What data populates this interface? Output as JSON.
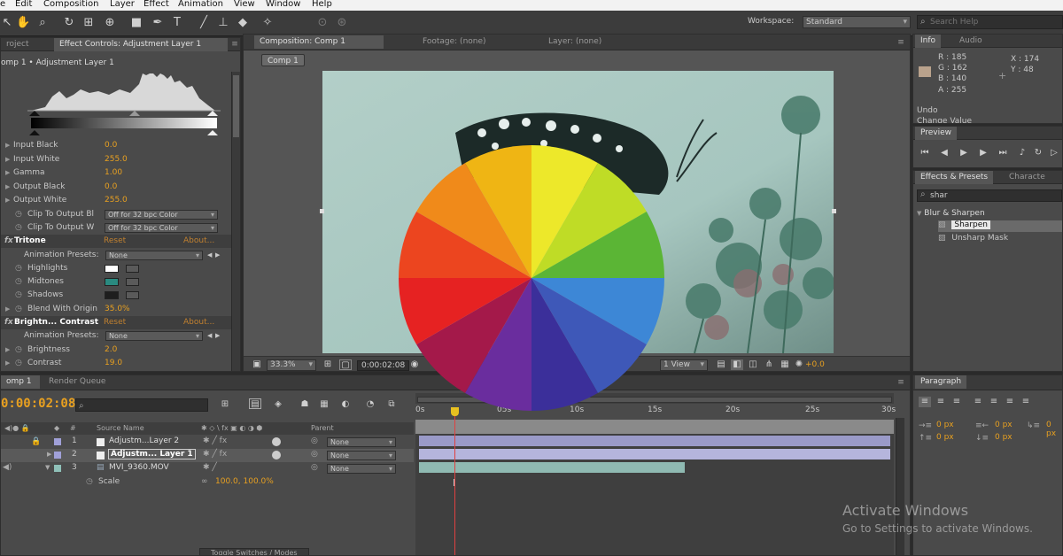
{
  "menu": [
    "e",
    "Edit",
    "Composition",
    "Layer",
    "Effect",
    "Animation",
    "View",
    "Window",
    "Help"
  ],
  "toolbar": {
    "workspace_label": "Workspace:",
    "workspace_value": "Standard",
    "search_placeholder": "Search Help"
  },
  "effect_panel": {
    "tab_project": "roject",
    "tab_effect_controls": "Effect Controls: Adjustment Layer 1",
    "breadcrumb": "omp 1 • Adjustment Layer 1",
    "levels": [
      {
        "label": "Input Black",
        "value": "0.0"
      },
      {
        "label": "Input White",
        "value": "255.0"
      },
      {
        "label": "Gamma",
        "value": "1.00"
      },
      {
        "label": "Output Black",
        "value": "0.0"
      },
      {
        "label": "Output White",
        "value": "255.0"
      },
      {
        "label": "Clip To Output Bl",
        "value": "Off for 32 bpc Color"
      },
      {
        "label": "Clip To Output W",
        "value": "Off for 32 bpc Color"
      }
    ],
    "tritone": {
      "name": "Tritone",
      "reset": "Reset",
      "about": "About...",
      "presets_label": "Animation Presets:",
      "presets_value": "None",
      "highlights": "Highlights",
      "midtones": "Midtones",
      "shadows": "Shadows",
      "blend_label": "Blend With Origin",
      "blend_value": "35.0%"
    },
    "brightness": {
      "name": "Brightn... Contrast",
      "reset": "Reset",
      "about": "About...",
      "presets_label": "Animation Presets:",
      "presets_value": "None",
      "brightness_label": "Brightness",
      "brightness_value": "2.0",
      "contrast_label": "Contrast",
      "contrast_value": "19.0"
    }
  },
  "comp_panel": {
    "tab_composition": "Composition: Comp 1",
    "tab_footage": "Footage: (none)",
    "tab_layer": "Layer: (none)",
    "comp_chip": "Comp 1",
    "zoom": "33.3%",
    "timecode": "0:00:02:08",
    "view": "1 View",
    "exposure": "+0.0"
  },
  "info_panel": {
    "tab_info": "Info",
    "tab_audio": "Audio",
    "r": "R : 185",
    "g": "G : 162",
    "b": "B : 140",
    "a": "A : 255",
    "x": "X : 174",
    "y": "Y : 48",
    "undo_label": "Undo",
    "undo_text": "Change Value"
  },
  "preview_panel": {
    "tab": "Preview"
  },
  "effects_presets": {
    "tab": "Effects & Presets",
    "tab2": "Characte",
    "search": "shar",
    "category": "Blur & Sharpen",
    "items": [
      "Sharpen",
      "Unsharp Mask"
    ]
  },
  "timeline": {
    "tab_comp": "omp 1",
    "tab_render": "Render Queue",
    "timecode": "0:00:02:08",
    "col_source": "Source Name",
    "col_parent": "Parent",
    "ruler": [
      "0s",
      "05s",
      "10s",
      "15s",
      "20s",
      "25s",
      "30s"
    ],
    "layers": [
      {
        "num": "1",
        "name": "Adjustm...Layer 2",
        "parent": "None"
      },
      {
        "num": "2",
        "name": "Adjustm... Layer 1",
        "parent": "None"
      },
      {
        "num": "3",
        "name": "MVI_9360.MOV",
        "parent": "None"
      }
    ],
    "scale_label": "Scale",
    "scale_value": "100.0, 100.0%",
    "toggle": "Toggle Switches / Modes"
  },
  "paragraph_panel": {
    "tab": "Paragraph",
    "v1": "0 px",
    "v2": "0 px",
    "v3": "0 px",
    "v4": "0 px",
    "v5": "0 px"
  },
  "watermark": {
    "title": "Activate Windows",
    "subtitle": "Go to Settings to activate Windows."
  },
  "colors": {
    "accent_value": "#e8a020",
    "highlight_swatch": "#ffffff",
    "midtone_swatch": "#2a8a80",
    "shadow_swatch": "#1e1e1e",
    "info_swatch": "#b9a28c"
  },
  "color_wheel": [
    "#ede82a",
    "#bfdc26",
    "#5bb535",
    "#3d87d6",
    "#3e58b8",
    "#3b2f9a",
    "#6a2d9e",
    "#a4194a",
    "#e62222",
    "#ec451f",
    "#f08a1a",
    "#efb514"
  ]
}
